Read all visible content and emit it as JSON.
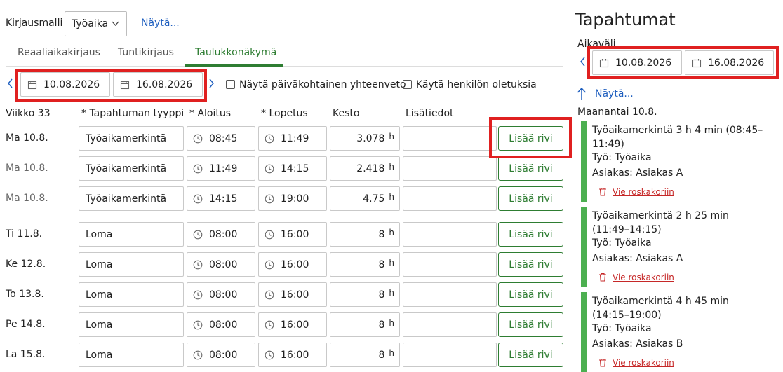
{
  "top": {
    "kirjausmalli_label": "Kirjausmalli",
    "kirjausmalli_value": "Työaika",
    "show_link": "Näytä..."
  },
  "tabs": [
    {
      "label": "Reaaliaikakirjaus",
      "active": false
    },
    {
      "label": "Tuntikirjaus",
      "active": false
    },
    {
      "label": "Taulukkonäkymä",
      "active": true
    }
  ],
  "range": {
    "start": "10.08.2026",
    "end": "16.08.2026"
  },
  "options": {
    "daily_summary": "Näytä päiväkohtainen yhteenveto",
    "person_defaults": "Käytä henkilön oletuksia"
  },
  "table": {
    "week": "Viikko 33",
    "headers": [
      "* Tapahtuman tyyppi",
      "* Aloitus",
      "* Lopetus",
      "Kesto",
      "Lisätiedot"
    ],
    "add_label": "Lisää rivi",
    "unit": "h",
    "rows": [
      {
        "day": "Ma 10.8.",
        "type": "Työaikamerkintä",
        "start": "08:45",
        "end": "11:49",
        "duration": "3.078"
      },
      {
        "day": "Ma 10.8.",
        "type": "Työaikamerkintä",
        "start": "11:49",
        "end": "14:15",
        "duration": "2.418"
      },
      {
        "day": "Ma 10.8.",
        "type": "Työaikamerkintä",
        "start": "14:15",
        "end": "19:00",
        "duration": "4.75"
      },
      {
        "day": "Ti 11.8.",
        "type": "Loma",
        "start": "08:00",
        "end": "16:00",
        "duration": "8"
      },
      {
        "day": "Ke 12.8.",
        "type": "Loma",
        "start": "08:00",
        "end": "16:00",
        "duration": "8"
      },
      {
        "day": "To 13.8.",
        "type": "Loma",
        "start": "08:00",
        "end": "16:00",
        "duration": "8"
      },
      {
        "day": "Pe 14.8.",
        "type": "Loma",
        "start": "08:00",
        "end": "16:00",
        "duration": "8"
      },
      {
        "day": "La 15.8.",
        "type": "Loma",
        "start": "08:00",
        "end": "16:00",
        "duration": "8"
      }
    ]
  },
  "side": {
    "title": "Tapahtumat",
    "aikavali_label": "Aikaväli",
    "start": "10.08.2026",
    "end": "16.08.2026",
    "show_link": "Näytä...",
    "day_heading": "Maanantai 10.8.",
    "delete_label": "Vie roskakoriin",
    "events": [
      {
        "title": "Työaikamerkintä 3 h 4 min (08:45–11:49)",
        "work": "Työ: Työaika",
        "customer": "Asiakas: Asiakas A"
      },
      {
        "title": "Työaikamerkintä 2 h 25 min (11:49–14:15)",
        "work": "Työ: Työaika",
        "customer": "Asiakas: Asiakas A"
      },
      {
        "title": "Työaikamerkintä 4 h 45 min (14:15–19:00)",
        "work": "Työ: Työaika",
        "customer": "Asiakas: Asiakas B"
      }
    ]
  },
  "colors": {
    "accent_green": "#2e7d32",
    "event_bar": "#4caf50",
    "link_blue": "#1f5fbf",
    "highlight_red": "#e02020",
    "delete_red": "#c62828"
  }
}
